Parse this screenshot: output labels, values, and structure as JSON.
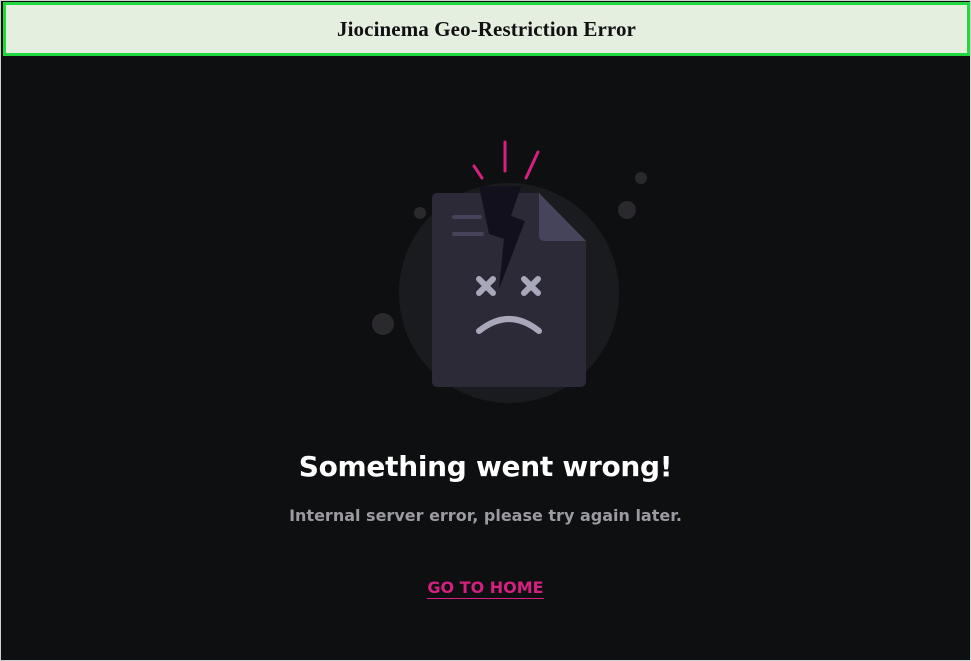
{
  "banner": {
    "title": "Jiocinema Geo-Restriction Error"
  },
  "error": {
    "heading": "Something went wrong!",
    "message": "Internal server error, please try again later.",
    "home_link": "GO TO HOME"
  },
  "icons": {
    "illustration": "broken-document-sad-face-icon"
  },
  "colors": {
    "background": "#0e0f11",
    "accent": "#d4207f",
    "banner_border": "#22d840",
    "banner_background": "#e4efdf"
  }
}
